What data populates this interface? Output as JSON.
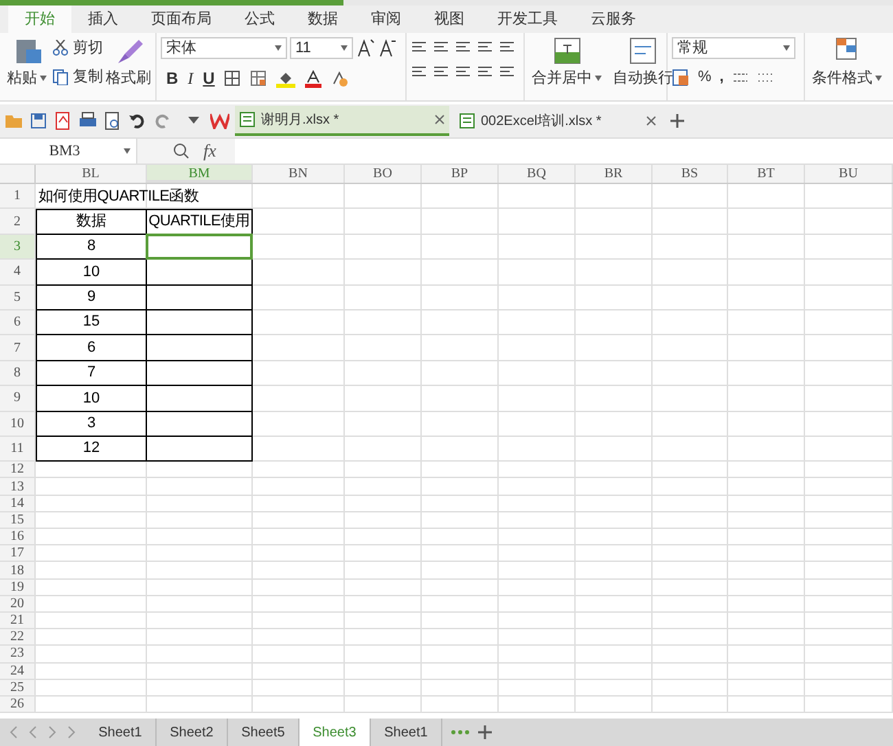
{
  "ribbon_tabs": [
    {
      "label": "开始",
      "selected": true
    },
    {
      "label": "插入",
      "selected": false
    },
    {
      "label": "页面布局",
      "selected": false
    },
    {
      "label": "公式",
      "selected": false
    },
    {
      "label": "数据",
      "selected": false
    },
    {
      "label": "审阅",
      "selected": false
    },
    {
      "label": "视图",
      "selected": false
    },
    {
      "label": "开发工具",
      "selected": false
    },
    {
      "label": "云服务",
      "selected": false
    }
  ],
  "clipboard": {
    "paste": "粘贴",
    "cut": "剪切",
    "copy": "复制",
    "format_painter": "格式刷"
  },
  "font": {
    "name": "宋体",
    "size": "11",
    "bold": "B",
    "italic": "I",
    "underline": "U"
  },
  "alignment": {
    "merge": "合并居中",
    "wrap": "自动换行"
  },
  "number": {
    "format": "常规",
    "percent": "%",
    "comma": ","
  },
  "styles": {
    "conditional": "条件格式"
  },
  "document_tabs": [
    {
      "label": "谢明月.xlsx *",
      "selected": true
    },
    {
      "label": "002Excel培训.xlsx *",
      "selected": false
    }
  ],
  "formula_bar": {
    "name_box": "BM3",
    "fx": "fx"
  },
  "columns": [
    {
      "label": "BL",
      "selected": false
    },
    {
      "label": "BM",
      "selected": true
    },
    {
      "label": "BN",
      "selected": false
    },
    {
      "label": "BO",
      "selected": false
    },
    {
      "label": "BP",
      "selected": false
    },
    {
      "label": "BQ",
      "selected": false
    },
    {
      "label": "BR",
      "selected": false
    },
    {
      "label": "BS",
      "selected": false
    },
    {
      "label": "BT",
      "selected": false
    },
    {
      "label": "BU",
      "selected": false
    }
  ],
  "rows": [
    {
      "number": "1",
      "kind": "title",
      "selected": false,
      "bordered": false,
      "cells": [
        "如何使用QUARTILE函数"
      ]
    },
    {
      "number": "2",
      "kind": "data",
      "selected": false,
      "bordered": true,
      "cells": [
        "数据",
        "QUARTILE使用"
      ]
    },
    {
      "number": "3",
      "kind": "data",
      "selected": true,
      "bordered": true,
      "cells": [
        "8"
      ]
    },
    {
      "number": "4",
      "kind": "data",
      "selected": false,
      "bordered": true,
      "cells": [
        "10"
      ]
    },
    {
      "number": "5",
      "kind": "data",
      "selected": false,
      "bordered": true,
      "cells": [
        "9"
      ]
    },
    {
      "number": "6",
      "kind": "data",
      "selected": false,
      "bordered": true,
      "cells": [
        "15"
      ]
    },
    {
      "number": "7",
      "kind": "data",
      "selected": false,
      "bordered": true,
      "cells": [
        "6"
      ]
    },
    {
      "number": "8",
      "kind": "data",
      "selected": false,
      "bordered": true,
      "cells": [
        "7"
      ]
    },
    {
      "number": "9",
      "kind": "data",
      "selected": false,
      "bordered": true,
      "cells": [
        "10"
      ]
    },
    {
      "number": "10",
      "kind": "data",
      "selected": false,
      "bordered": true,
      "cells": [
        "3"
      ]
    },
    {
      "number": "11",
      "kind": "data",
      "selected": false,
      "bordered": true,
      "cells": [
        "12"
      ]
    },
    {
      "number": "12",
      "kind": "empty",
      "selected": false,
      "bordered": false,
      "cells": []
    },
    {
      "number": "13",
      "kind": "empty",
      "selected": false,
      "bordered": false,
      "cells": []
    },
    {
      "number": "14",
      "kind": "empty",
      "selected": false,
      "bordered": false,
      "cells": []
    },
    {
      "number": "15",
      "kind": "empty",
      "selected": false,
      "bordered": false,
      "cells": []
    },
    {
      "number": "16",
      "kind": "empty",
      "selected": false,
      "bordered": false,
      "cells": []
    },
    {
      "number": "17",
      "kind": "empty",
      "selected": false,
      "bordered": false,
      "cells": []
    },
    {
      "number": "18",
      "kind": "empty",
      "selected": false,
      "bordered": false,
      "cells": []
    },
    {
      "number": "19",
      "kind": "empty",
      "selected": false,
      "bordered": false,
      "cells": []
    },
    {
      "number": "20",
      "kind": "empty",
      "selected": false,
      "bordered": false,
      "cells": []
    },
    {
      "number": "21",
      "kind": "empty",
      "selected": false,
      "bordered": false,
      "cells": []
    },
    {
      "number": "22",
      "kind": "empty",
      "selected": false,
      "bordered": false,
      "cells": []
    },
    {
      "number": "23",
      "kind": "empty",
      "selected": false,
      "bordered": false,
      "cells": []
    },
    {
      "number": "24",
      "kind": "empty",
      "selected": false,
      "bordered": false,
      "cells": []
    },
    {
      "number": "25",
      "kind": "empty",
      "selected": false,
      "bordered": false,
      "cells": []
    },
    {
      "number": "26",
      "kind": "empty",
      "selected": false,
      "bordered": false,
      "cells": []
    }
  ],
  "sheet_tabs": [
    {
      "label": "Sheet1",
      "selected": false
    },
    {
      "label": "Sheet2",
      "selected": false
    },
    {
      "label": "Sheet5",
      "selected": false
    },
    {
      "label": "Sheet3",
      "selected": true
    },
    {
      "label": "Sheet1",
      "selected": false
    }
  ]
}
